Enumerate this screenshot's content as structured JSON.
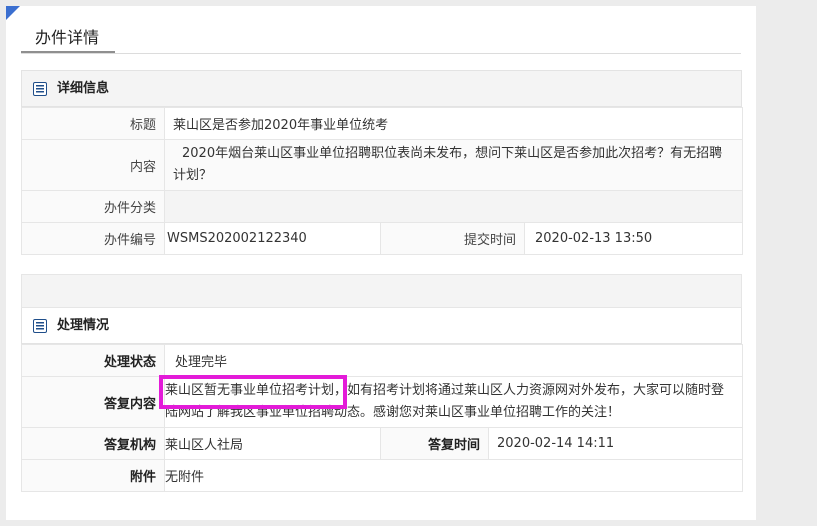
{
  "page": {
    "title": "办件详情"
  },
  "detail": {
    "section_title": "详细信息",
    "rows": {
      "title_label": "标题",
      "title_value": "莱山区是否参加2020年事业单位统考",
      "content_label": "内容",
      "content_value": "2020年烟台莱山区事业单位招聘职位表尚未发布，想问下莱山区是否参加此次招考？有无招聘计划？",
      "category_label": "办件分类",
      "category_value": "",
      "number_label": "办件编号",
      "number_value": "WSMS202002122340",
      "submit_time_label": "提交时间",
      "submit_time_value": "2020-02-13 13:50"
    }
  },
  "processing": {
    "section_title": "处理情况",
    "status_label": "处理状态",
    "status_value": "处理完毕",
    "reply_label": "答复内容",
    "reply_value": "莱山区暂无事业单位招考计划，如有招考计划将通过莱山区人力资源网对外发布，大家可以随时登陆网站了解我区事业单位招聘动态。感谢您对莱山区事业单位招聘工作的关注！",
    "org_label": "答复机构",
    "org_value": "莱山区人社局",
    "reply_time_label": "答复时间",
    "reply_time_value": "2020-02-14 14:11",
    "attachment_label": "附件",
    "attachment_value": "无附件"
  },
  "colors": {
    "accent": "#3b6fd0",
    "highlight": "#e31bd8",
    "section_icon": "#1f4e8a"
  }
}
